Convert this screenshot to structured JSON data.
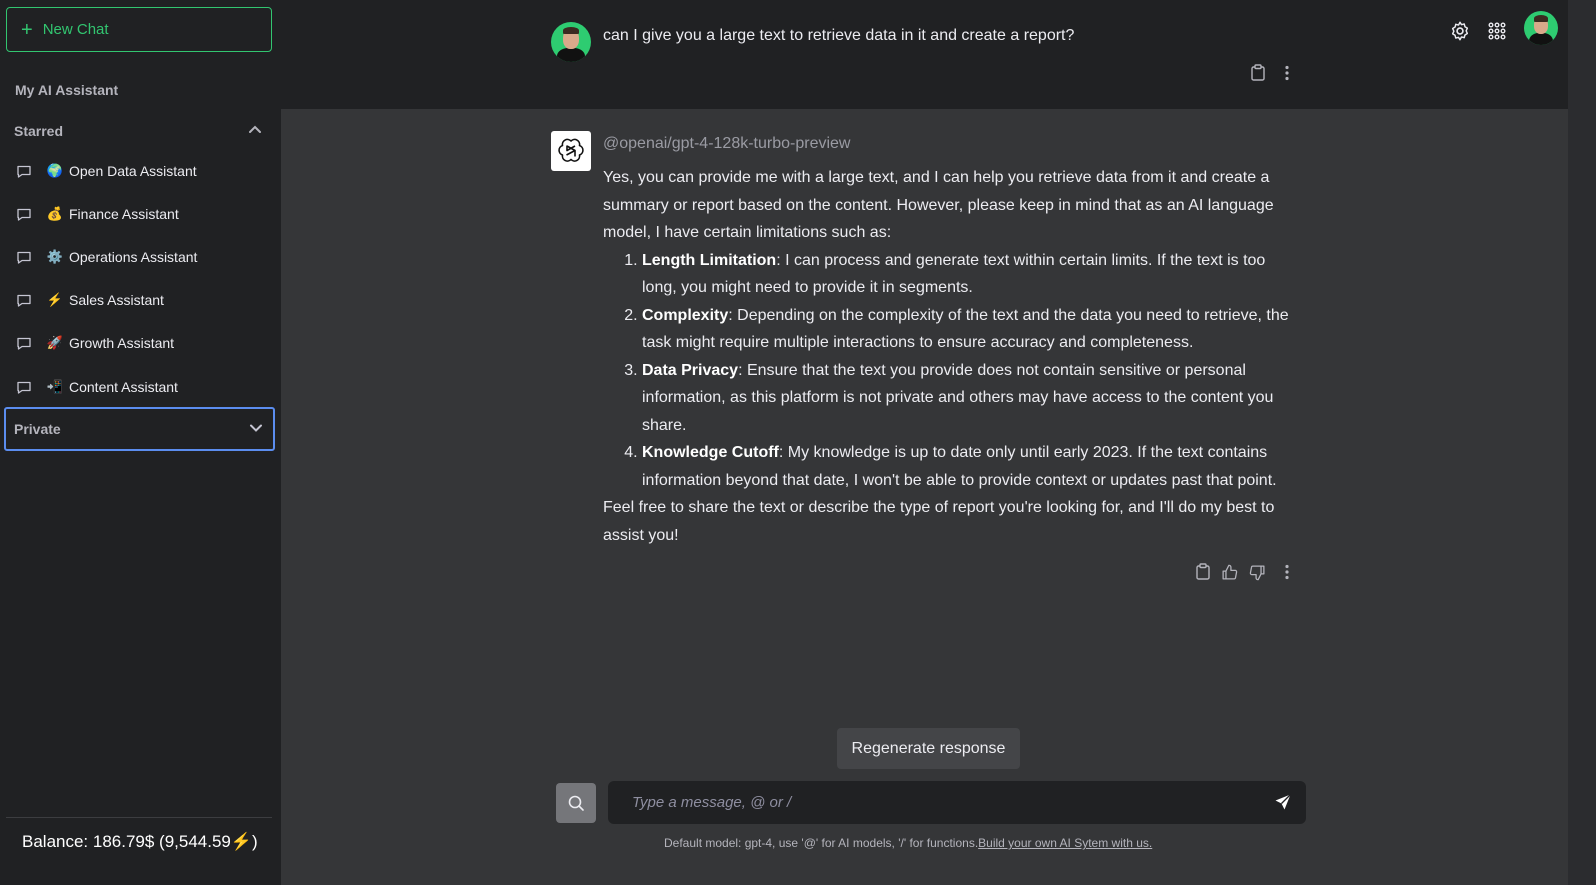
{
  "sidebar": {
    "new_chat_label": "New Chat",
    "section_title": "My AI Assistant",
    "starred_label": "Starred",
    "starred_items": [
      {
        "emoji": "🌍",
        "label": "Open Data Assistant"
      },
      {
        "emoji": "💰",
        "label": "Finance Assistant"
      },
      {
        "emoji": "⚙️",
        "label": "Operations Assistant"
      },
      {
        "emoji": "⚡",
        "label": "Sales Assistant"
      },
      {
        "emoji": "🚀",
        "label": "Growth Assistant"
      },
      {
        "emoji": "📲",
        "label": "Content Assistant"
      }
    ],
    "private_label": "Private",
    "balance": "Balance: 186.79$ (9,544.59⚡)"
  },
  "conversation": {
    "user_message": "can I give you a large text to retrieve data in it and create a report?",
    "model_name": "@openai/gpt-4-128k-turbo-preview",
    "intro": "Yes, you can provide me with a large text, and I can help you retrieve data from it and create a summary or report based on the content. However, please keep in mind that as an AI language model, I have certain limitations such as:",
    "points": [
      {
        "title": "Length Limitation",
        "text": ": I can process and generate text within certain limits. If the text is too long, you might need to provide it in segments."
      },
      {
        "title": "Complexity",
        "text": ": Depending on the complexity of the text and the data you need to retrieve, the task might require multiple interactions to ensure accuracy and completeness."
      },
      {
        "title": "Data Privacy",
        "text": ": Ensure that the text you provide does not contain sensitive or personal information, as this platform is not private and others may have access to the content you share."
      },
      {
        "title": "Knowledge Cutoff",
        "text": ": My knowledge is up to date only until early 2023. If the text contains information beyond that date, I won't be able to provide context or updates past that point."
      }
    ],
    "outro": "Feel free to share the text or describe the type of report you're looking for, and I'll do my best to assist you!"
  },
  "composer": {
    "regenerate_label": "Regenerate response",
    "placeholder": "Type a message, @ or /",
    "footer_text": "Default model: gpt-4, use '@' for AI models, '/' for functions.",
    "footer_link": "Build your own AI Sytem with us."
  },
  "colors": {
    "accent_green": "#32c570",
    "focus_blue": "#5b8def",
    "sidebar_bg": "#202123",
    "main_bg": "#353638"
  }
}
